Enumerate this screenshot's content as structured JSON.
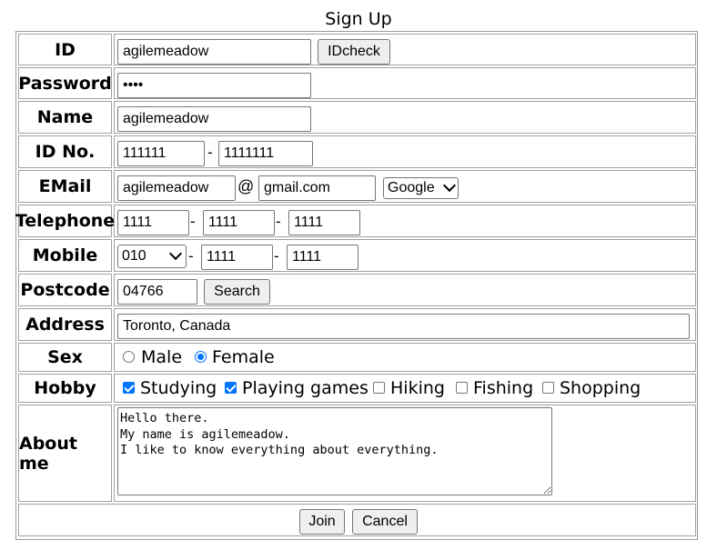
{
  "page": {
    "title": "Sign Up"
  },
  "labels": {
    "id": "ID",
    "password": "Password",
    "name": "Name",
    "idno": "ID No.",
    "email": "EMail",
    "telephone": "Telephone",
    "mobile": "Mobile",
    "postcode": "Postcode",
    "address": "Address",
    "sex": "Sex",
    "hobby": "Hobby",
    "about": "About me"
  },
  "fields": {
    "id_value": "agilemeadow",
    "idcheck_label": "IDcheck",
    "password_value": "••••",
    "name_value": "agilemeadow",
    "idno_first": "111111",
    "idno_second": "1111111",
    "email_user": "agilemeadow",
    "email_at": "@",
    "email_domain": "gmail.com",
    "email_provider_selected": "Google",
    "tel_1": "1111",
    "tel_2": "1111",
    "tel_3": "1111",
    "mobile_prefix_selected": "010",
    "mobile_2": "1111",
    "mobile_3": "1111",
    "postcode_value": "04766",
    "search_label": "Search",
    "address_value": "Toronto, Canada",
    "dash": "-"
  },
  "sex": {
    "options": [
      {
        "label": "Male",
        "checked": false
      },
      {
        "label": "Female",
        "checked": true
      }
    ]
  },
  "hobby": {
    "options": [
      {
        "label": "Studying",
        "checked": true
      },
      {
        "label": "Playing games",
        "checked": true
      },
      {
        "label": "Hiking",
        "checked": false
      },
      {
        "label": "Fishing",
        "checked": false
      },
      {
        "label": "Shopping",
        "checked": false
      }
    ]
  },
  "about": {
    "text": "Hello there.\nMy name is agilemeadow.\nI like to know everything about everything."
  },
  "actions": {
    "join_label": "Join",
    "cancel_label": "Cancel"
  },
  "colors": {
    "accent": "#0075ff",
    "border": "#a0a0a0",
    "button_bg": "#efefef"
  }
}
